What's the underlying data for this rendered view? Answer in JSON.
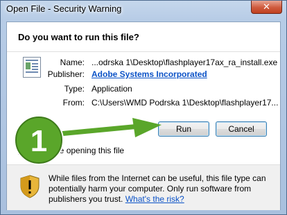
{
  "window": {
    "title": "Open File - Security Warning",
    "close_glyph": "✕"
  },
  "dialog": {
    "question": "Do you want to run this file?",
    "fields": [
      {
        "label": "Name:",
        "value": "...odrska 1\\Desktop\\flashplayer17ax_ra_install.exe"
      },
      {
        "label": "Publisher:",
        "value": "Adobe Systems Incorporated"
      },
      {
        "label": "Type:",
        "value": "Application"
      },
      {
        "label": "From:",
        "value": "C:\\Users\\WMD Podrska 1\\Desktop\\flashplayer17..."
      }
    ],
    "run_label": "Run",
    "cancel_label": "Cancel",
    "always_ask_label": "sk before opening this file",
    "always_ask_checked": false
  },
  "warning": {
    "text": "While files from the Internet can be useful, this file type can potentially harm your computer. Only run software from publishers you trust.",
    "link": "What's the risk?"
  },
  "annotation": {
    "step_number": "1",
    "colors": {
      "green": "#5aa62a",
      "badge_dark": "#3d7a1a"
    }
  },
  "icons": [
    "close-icon",
    "application-file-icon",
    "shield-warning-icon",
    "step-badge",
    "pointer-arrow"
  ]
}
